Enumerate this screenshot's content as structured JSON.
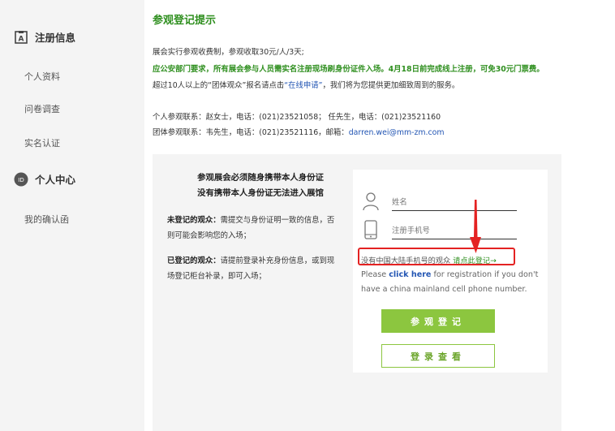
{
  "sidebar": {
    "sections": [
      {
        "icon": "id-card-icon",
        "title": "注册信息"
      },
      {
        "icon": "id-badge-icon",
        "title": "个人中心",
        "badge": "ID"
      }
    ],
    "items": [
      {
        "label": "个人资料"
      },
      {
        "label": "问卷调查"
      },
      {
        "label": "实名认证"
      },
      {
        "label": "我的确认函"
      }
    ]
  },
  "main": {
    "title": "参观登记提示",
    "lines": [
      "展会实行参观收费制，参观收取30元/人/3天;",
      "应公安部门要求，所有展会参与人员需实名注册现场刷身份证件入场。4月18日前完成线上注册，可免30元门票费。",
      "超过10人以上的“团体观众”报名请点击",
      "“在线申请”",
      "，我们将为您提供更加细致周到的服务。"
    ],
    "contacts": {
      "personal": "个人参观联系：赵女士，电话：(021)23521058； 任先生，电话：(021)23521160",
      "group_prefix": "团体参观联系：韦先生，电话：(021)23521116，邮箱：",
      "group_email": "darren.wei@mm-zm.com"
    }
  },
  "panel": {
    "notice_line1": "参观展会必须随身携带本人身份证",
    "notice_line2": "没有携带本人身份证无法进入展馆",
    "unregistered_label": "未登记的观众：",
    "unregistered_text": "需提交与身份证明一致的信息，否则可能会影响您的入场；",
    "registered_label": "已登记的观众：",
    "registered_text": "请提前登录补充身份信息，或到现场登记柜台补录，即可入场；",
    "form": {
      "name_placeholder": "姓名",
      "phone_placeholder": "注册手机号",
      "hint_cn_prefix": "没有中国大陆手机号的观众 ",
      "hint_cn_link": "请点此登记→",
      "hint_en_prefix": "Please ",
      "hint_en_link": "click here",
      "hint_en_suffix": " for registration if you don't have a china mainland cell phone number.",
      "submit_label": "参观登记",
      "login_label": "登录查看"
    }
  },
  "colors": {
    "accent_green": "#8cc63f",
    "title_green": "#2f8f1f",
    "highlight_red": "#e42222",
    "link_blue": "#2255b3"
  }
}
